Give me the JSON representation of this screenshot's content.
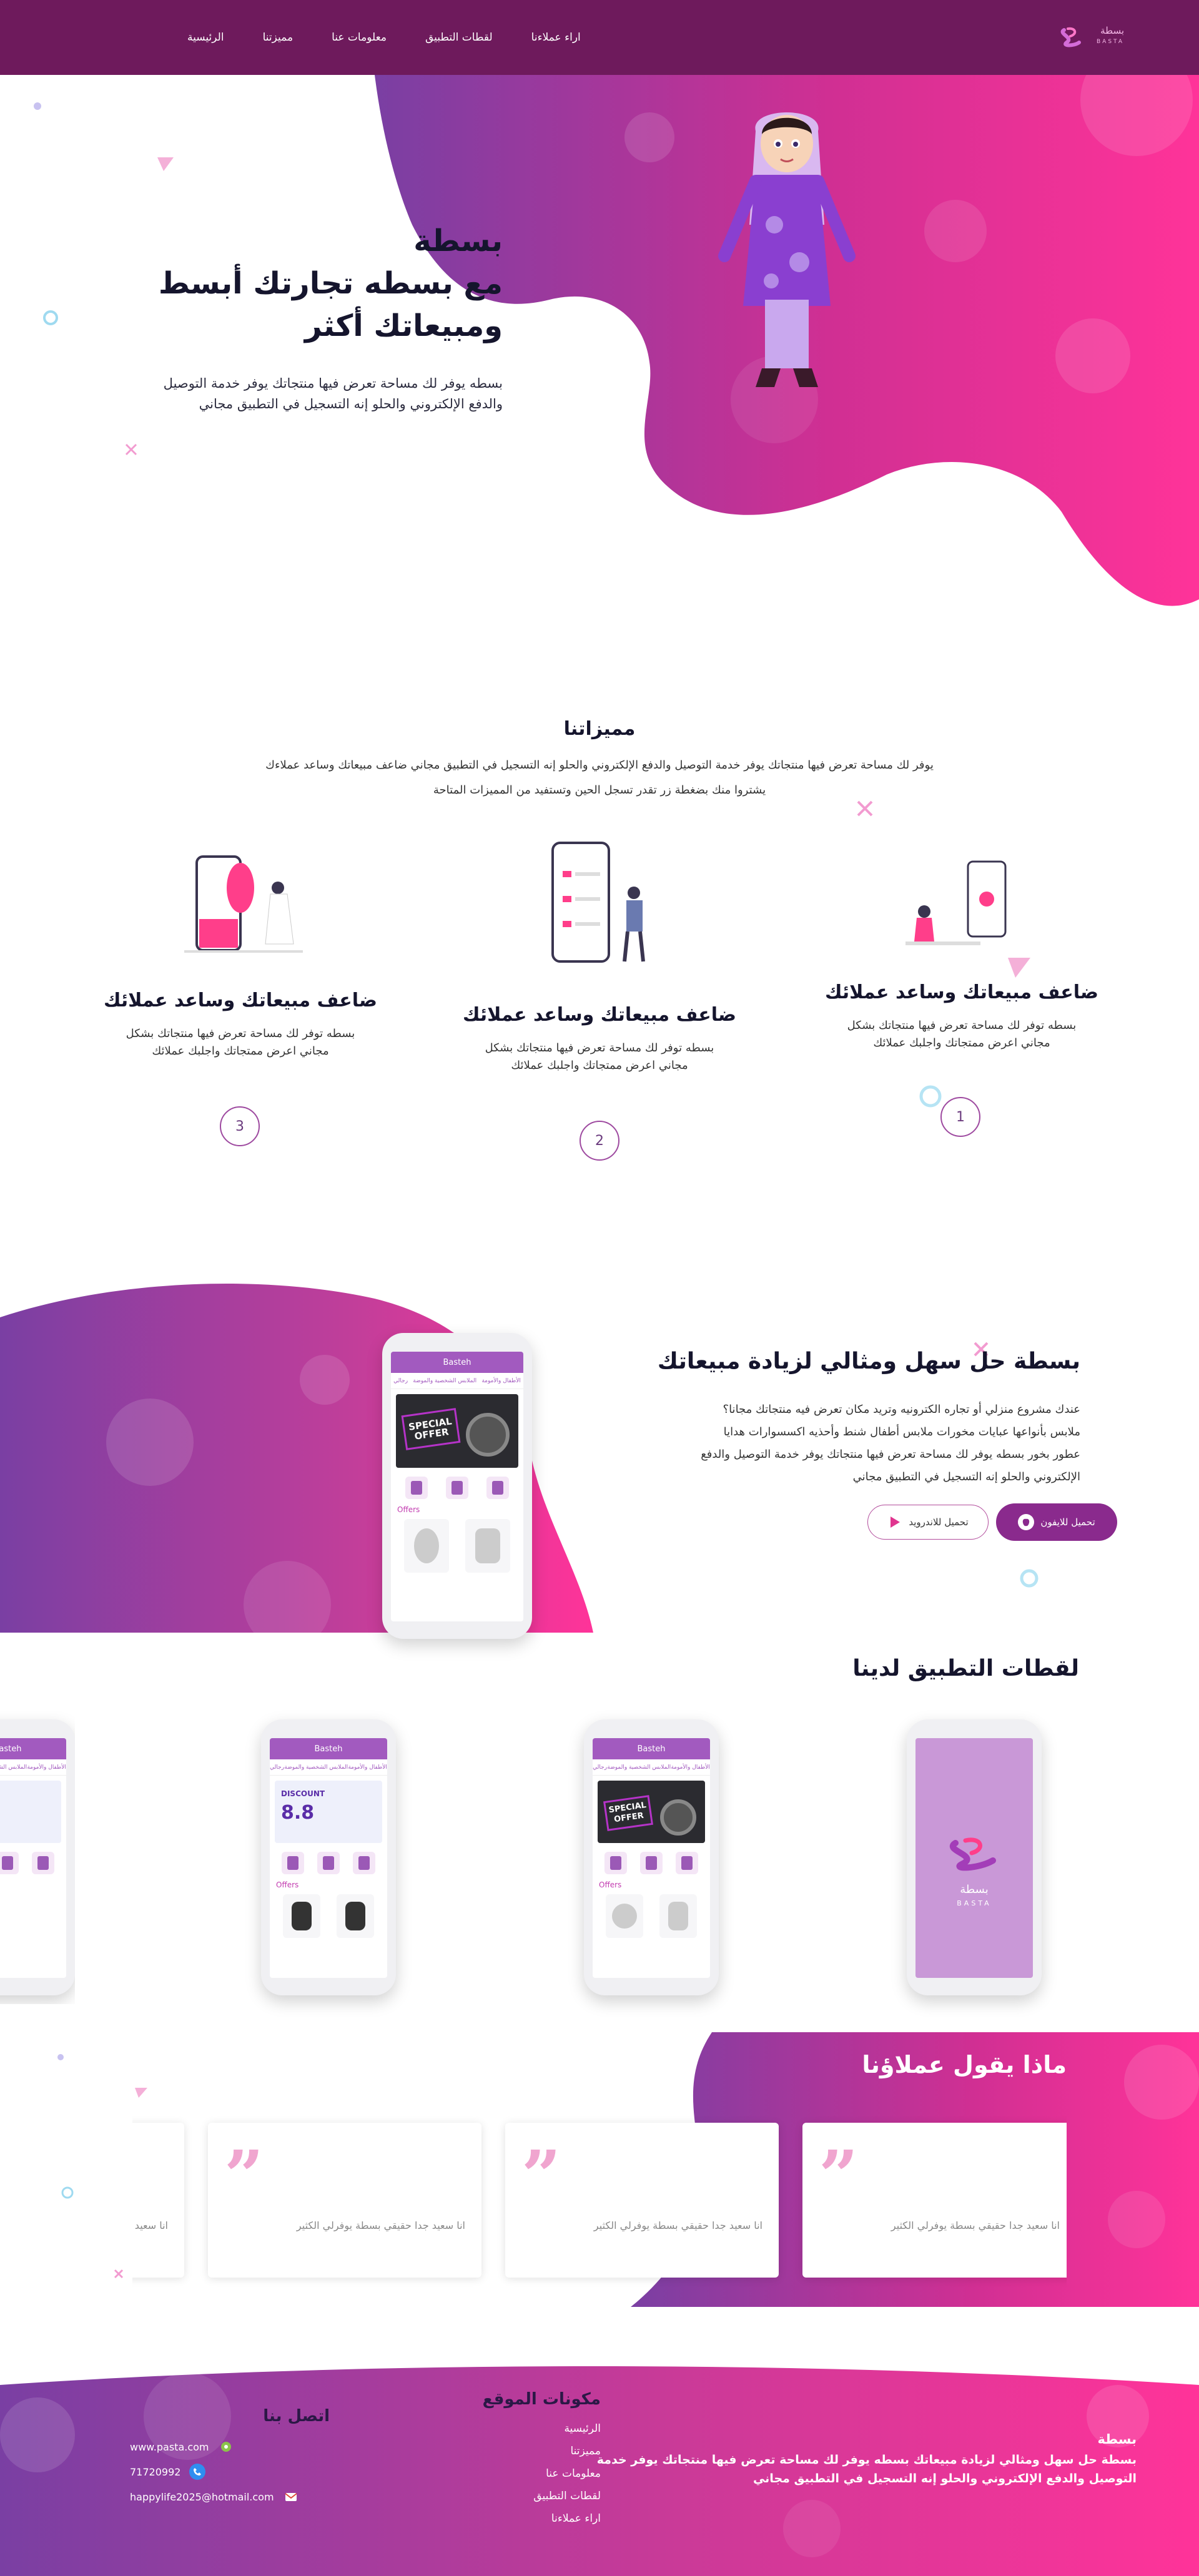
{
  "nav": {
    "items": [
      "الرئيسية",
      "مميزتنا",
      "معلومات عنا",
      "لقطات التطبيق",
      "اراء عملاءنا"
    ],
    "logo_ar": "بسطة",
    "logo_en": "BASTA"
  },
  "hero": {
    "title_line1": "بسطة",
    "title_line2": "مع بسطه تجارتك أبسط",
    "title_line3": "ومبيعاتك أكثر",
    "text": "بسطه يوفر لك مساحة تعرض فيها منتجاتك يوفر خدمة التوصيل والدفع الإلكتروني والحلو إنه التسجيل في التطبيق مجاني"
  },
  "features": {
    "title": "مميزاتنا",
    "intro_line1": "يوفر لك مساحة تعرض فيها منتجاتك يوفر خدمة التوصيل والدفع الإلكتروني والحلو إنه التسجيل في التطبيق مجاني ضاعف مبيعاتك وساعد عملاءك",
    "intro_line2": "يشتروا منك بضغطة زر تقدر تسجل الحين وتستفيد من المميزات المتاحة",
    "items": [
      {
        "title": "ضاعف مبيعاتك وساعد عملائك",
        "text": "بسطه توفر لك مساحة تعرض فيها منتجاتك بشكل مجاني اعرض ممتجاتك واجلبك عملائك",
        "num": "1"
      },
      {
        "title": "ضاعف مبيعاتك وساعد عملائك",
        "text": "بسطه توفر لك مساحة تعرض فيها منتجاتك بشكل مجاني اعرض ممتجاتك واجلبك عملائك",
        "num": "2"
      },
      {
        "title": "ضاعف مبيعاتك وساعد عملائك",
        "text": "بسطه توفر لك مساحة تعرض فيها منتجاتك بشكل مجاني اعرض ممتجاتك واجلبك عملائك",
        "num": "3"
      }
    ]
  },
  "app": {
    "title": "بسطة حل سهل ومثالي لزيادة مبيعاتك",
    "text": "عندك مشروع منزلي أو تجاره الكترونيه وتريد مكان تعرض فيه منتجاتك مجانا؟ ملابس بأنواعها عبايات مخورات ملابس أطفال شنط وأحذيه اكسسوارات هدايا عطور بخور بسطه يوفر لك مساحة تعرض فيها منتجاتك يوفر خدمة التوصيل والدفع الإلكتروني والحلو إنه التسجيل في التطبيق مجاني",
    "ios_label": "تحميل للايفون",
    "android_label": "تحميل للاندرويد",
    "phone_header": "Basteh",
    "phone_tabs": [
      "الأطفال والأمومة",
      "الملابس الشخصية والموضة",
      "رجالي"
    ],
    "phone_offer": "SPECIAL OFFER",
    "phone_offers_label": "Offers"
  },
  "shots": {
    "title": "لقطات التطبيق لدينا",
    "discount": "8.8",
    "discount_label": "DISCOUNT",
    "splash_ar": "بسطة",
    "splash_en": "BASTA"
  },
  "testimonials": {
    "title": "ماذا يقول عملاؤنا",
    "quote": "انا سعيد جدا حقيقي بسطة يوفرلي الكثير"
  },
  "footer": {
    "about_title": "بسطة",
    "about_text": "بسطة حل سهل ومثالي لزيادة مبيعاتك بسطه يوفر لك مساحة تعرض فيها منتجاتك يوفر خدمة التوصيل والدفع الإلكتروني والحلو إنه التسجيل في التطبيق مجاني",
    "links_title": "مكونات الموقع",
    "links": [
      "الرئيسية",
      "مميزتنا",
      "معلومات عنا",
      "لقطات التطبيق",
      "اراء عملاءنا"
    ],
    "contact_title": "اتصل بنا",
    "website": "www.pasta.com",
    "phone": "71720992",
    "email": "happylife2025@hotmail.com"
  },
  "colors": {
    "primary": "#6e1a5c",
    "accent": "#ff3399",
    "purple": "#7a3fa3"
  },
  "icons": [
    "logo-icon",
    "apple-icon",
    "play-store-icon",
    "quote-icon",
    "globe-icon",
    "phone-icon",
    "mail-icon"
  ]
}
